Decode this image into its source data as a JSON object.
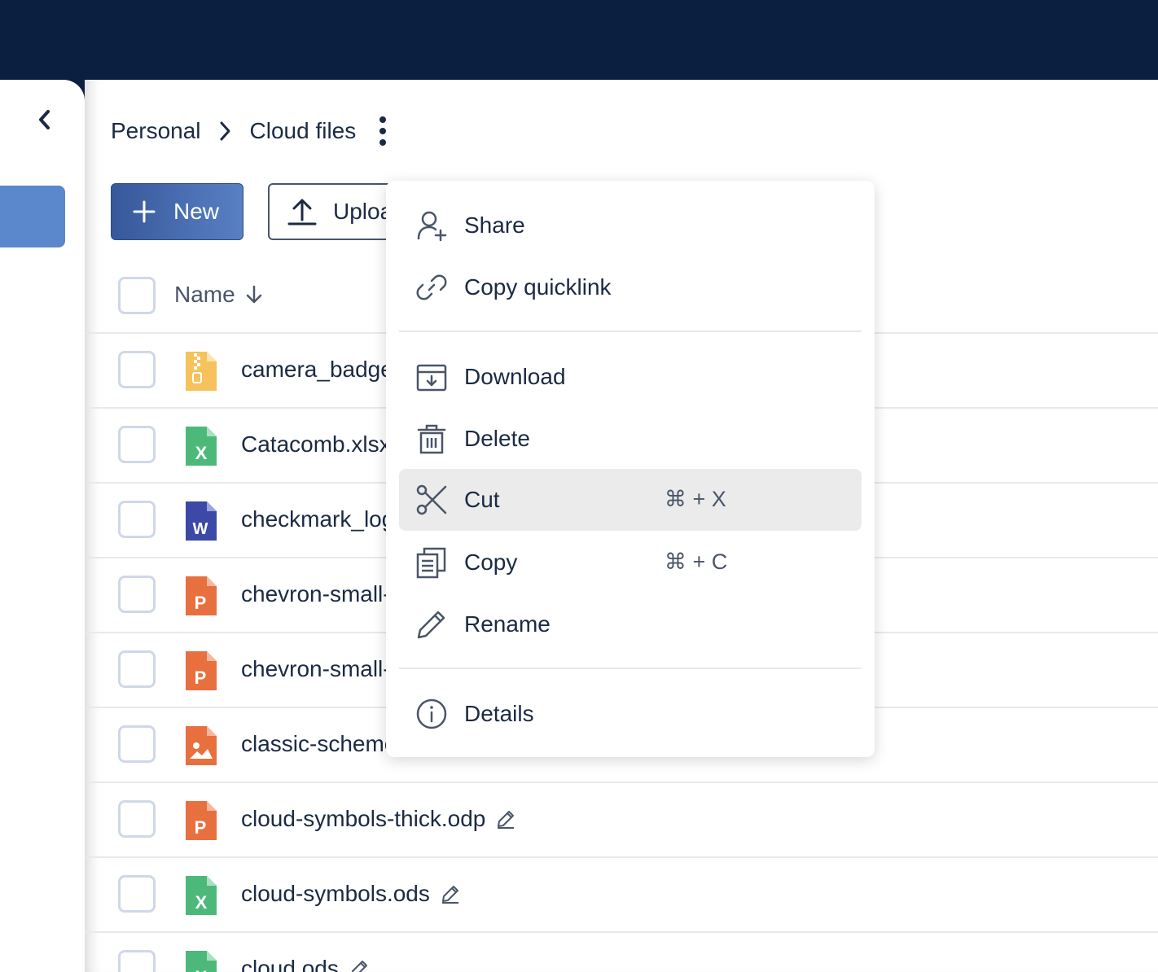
{
  "sidebar": {
    "collapse_icon": "chevron-left-icon"
  },
  "breadcrumb": {
    "items": [
      "Personal",
      "Cloud files"
    ]
  },
  "toolbar": {
    "new_label": "New",
    "upload_label": "Upload"
  },
  "table": {
    "name_header": "Name",
    "sort": "descending",
    "rows": [
      {
        "name": "camera_badge.zip",
        "type": "zip"
      },
      {
        "name": "Catacomb.xlsx",
        "type": "spreadsheet"
      },
      {
        "name": "checkmark_logo.docx",
        "type": "document"
      },
      {
        "name": "chevron-small-left.pptx",
        "type": "presentation"
      },
      {
        "name": "chevron-small-right.pptx",
        "type": "presentation"
      },
      {
        "name": "classic-scheme.png",
        "type": "image"
      },
      {
        "name": "cloud-symbols-thick.odp",
        "type": "presentation"
      },
      {
        "name": "cloud-symbols.ods",
        "type": "spreadsheet"
      },
      {
        "name": "cloud.ods",
        "type": "spreadsheet"
      }
    ]
  },
  "context_menu": {
    "share": "Share",
    "copy_quicklink": "Copy quicklink",
    "download": "Download",
    "delete": "Delete",
    "cut": "Cut",
    "cut_shortcut": "⌘ + X",
    "copy": "Copy",
    "copy_shortcut": "⌘ + C",
    "rename": "Rename",
    "details": "Details"
  },
  "colors": {
    "topbar": "#0b1f40",
    "primary": "#4a6fb5",
    "sidebar_active": "#5b87cd",
    "zip": "#f6c25b",
    "spreadsheet": "#4cb97b",
    "document": "#3c49a6",
    "presentation": "#e8703f",
    "image": "#e8703f",
    "menu_hover": "#ebebeb"
  }
}
